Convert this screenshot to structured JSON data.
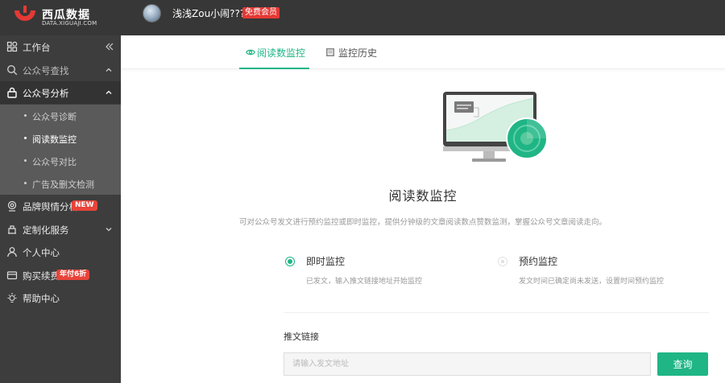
{
  "brand": {
    "name": "西瓜数据",
    "domain": "DATA.XIGUAJI.COM",
    "accent": "#1fb585"
  },
  "header": {
    "user_name": "浅浅Zou小闹????",
    "vip_label": "免费会员"
  },
  "sidebar": {
    "items": [
      {
        "label": "工作台",
        "icon": "dashboard-icon"
      },
      {
        "label": "公众号查找",
        "icon": "search-icon"
      },
      {
        "label": "公众号分析",
        "icon": "lock-icon"
      },
      {
        "label": "品牌舆情分析",
        "icon": "target-icon",
        "badge": "NEW"
      },
      {
        "label": "定制化服务",
        "icon": "service-icon"
      },
      {
        "label": "个人中心",
        "icon": "user-icon"
      },
      {
        "label": "购买续费",
        "icon": "card-icon",
        "badge": "年付6折"
      },
      {
        "label": "帮助中心",
        "icon": "bulb-icon"
      }
    ],
    "sub_items": [
      {
        "label": "公众号诊断"
      },
      {
        "label": "阅读数监控",
        "current": true
      },
      {
        "label": "公众号对比"
      },
      {
        "label": "广告及删文检测"
      }
    ]
  },
  "tabs": [
    {
      "label": "阅读数监控",
      "active": true
    },
    {
      "label": "监控历史",
      "active": false
    }
  ],
  "main": {
    "title": "阅读数监控",
    "description": "可对公众号发文进行预约监控或即时监控，提供分钟级的文章阅读数点赞数监测，掌握公众号文章阅读走向。",
    "options": [
      {
        "title": "即时监控",
        "desc": "已发文，输入推文链接地址开始监控",
        "selected": true
      },
      {
        "title": "预约监控",
        "desc": "发文时间已确定尚未发送，设置时间预约监控",
        "selected": false
      }
    ],
    "field_label": "推文链接",
    "input_placeholder": "请输入发文地址",
    "input_value": "",
    "submit_label": "查询"
  }
}
